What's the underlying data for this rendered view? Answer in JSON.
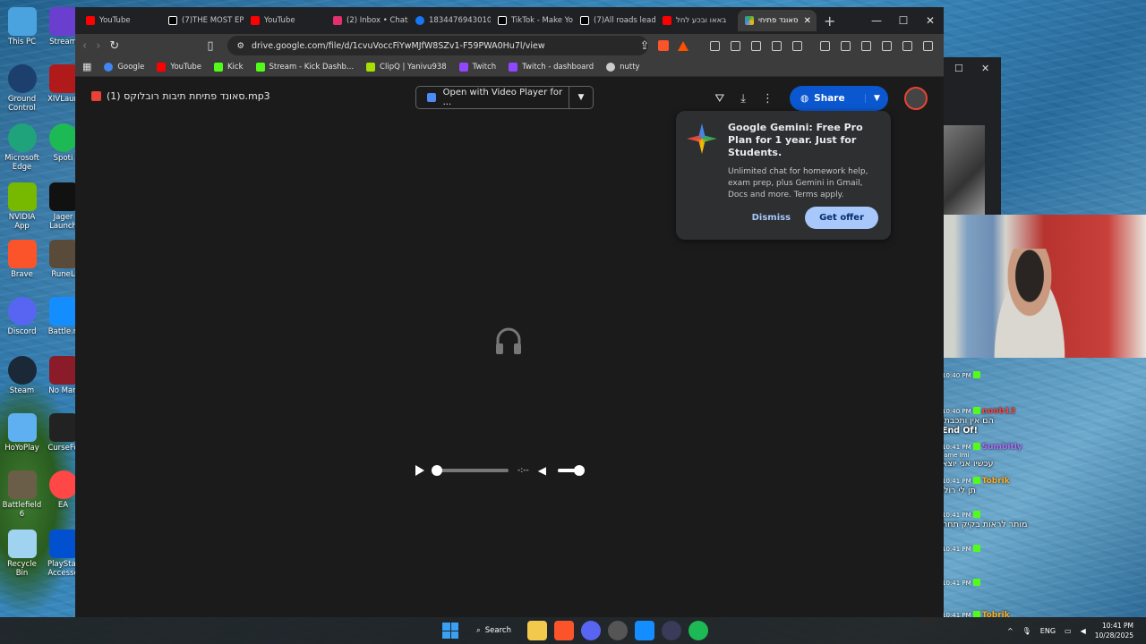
{
  "desktop": {
    "icons": [
      {
        "label": "This PC"
      },
      {
        "label": "Stream"
      },
      {
        "label": "Ground Control"
      },
      {
        "label": "XIVLaun"
      },
      {
        "label": "Microsoft Edge"
      },
      {
        "label": "Spoti"
      },
      {
        "label": "NVIDIA App"
      },
      {
        "label": "Jager Launch"
      },
      {
        "label": "Brave"
      },
      {
        "label": "RuneL"
      },
      {
        "label": "Discord"
      },
      {
        "label": "Battle.n"
      },
      {
        "label": "Steam"
      },
      {
        "label": "No Man"
      },
      {
        "label": "HoYoPlay"
      },
      {
        "label": "CurseFo"
      },
      {
        "label": "Battlefield 6"
      },
      {
        "label": "EA"
      },
      {
        "label": "Recycle Bin"
      },
      {
        "label": "PlayStat Accesso"
      }
    ]
  },
  "browser": {
    "tabs": [
      {
        "label": "YouTube",
        "color": "#ff0000"
      },
      {
        "label": "(7)THE MOST EP",
        "color": "#000000"
      },
      {
        "label": "YouTube",
        "color": "#ff0000"
      },
      {
        "label": "(2) Inbox • Chats",
        "color": "#e1306c"
      },
      {
        "label": "1834476943010",
        "color": "#1877f2"
      },
      {
        "label": "TikTok - Make Yo",
        "color": "#000000"
      },
      {
        "label": "(7)All roads lead",
        "color": "#000000"
      },
      {
        "label": "באאו ובכע לחל",
        "color": "#ff0000"
      },
      {
        "label": "סאונד פתיחי",
        "color": "#34a853"
      }
    ],
    "new_tab": "+",
    "window_controls": {
      "minimize": "—",
      "maximize": "☐",
      "close": "✕"
    },
    "url": "drive.google.com/file/d/1cvuVoccFiYwMJfW8SZv1-F59PWA0Hu7l/view",
    "bookmarks": [
      {
        "label": "Google",
        "color": "#4285f4"
      },
      {
        "label": "YouTube",
        "color": "#ff0000"
      },
      {
        "label": "Kick",
        "color": "#53fc18"
      },
      {
        "label": "Stream - Kick Dashb...",
        "color": "#53fc18"
      },
      {
        "label": "ClipQ | Yanivu938",
        "color": "#a8e000"
      },
      {
        "label": "Twitch",
        "color": "#9146ff"
      },
      {
        "label": "Twitch - dashboard",
        "color": "#9146ff"
      },
      {
        "label": "nutty",
        "color": "#cccccc"
      }
    ]
  },
  "drive": {
    "file_title": "(1) סאונד פתיחת תיבות רובלוקס.mp3",
    "open_with": "Open with Video Player for ...",
    "share": "Share",
    "gemini": {
      "title": "Google Gemini: Free Pro Plan for 1 year. Just for Students.",
      "body": "Unlimited chat for homework help, exam prep, plus Gemini in Gmail, Docs and more. Terms apply.",
      "dismiss": "Dismiss",
      "get_offer": "Get offer"
    },
    "player": {
      "time": "-:--"
    }
  },
  "chat": [
    {
      "time": "10:40 PM",
      "name": "",
      "msg": "",
      "color": "#2e9cff"
    },
    {
      "time": "10:40 PM",
      "name": "noob13",
      "msg": "הם אין ותכבתו",
      "color": "#ff4040"
    },
    {
      "time": "10:41 PM",
      "name": "Sumbitly",
      "msg": "עכשיו אני יוצא",
      "color": "#b070ff"
    },
    {
      "time": "10:41 PM",
      "name": "Tobrik",
      "msg": "תן לי רולי",
      "color": "#ffb020"
    },
    {
      "time": "10:41 PM",
      "name": "",
      "msg": "מותר לראות בקיק תחת",
      "color": "#ff4040"
    },
    {
      "time": "10:41 PM",
      "name": "",
      "msg": "",
      "color": "#ff4040"
    },
    {
      "time": "10:41 PM",
      "name": "",
      "msg": "",
      "color": "#ff4040"
    },
    {
      "time": "10:41 PM",
      "name": "Tobrik",
      "msg": "",
      "color": "#ffb020"
    }
  ],
  "chat_overlay_text": {
    "line1": "End Of!",
    "line2": "Jame Imi"
  },
  "taskbar": {
    "search": "Search",
    "lang": "ENG",
    "time": "10:41 PM",
    "date": "10/28/2025"
  }
}
